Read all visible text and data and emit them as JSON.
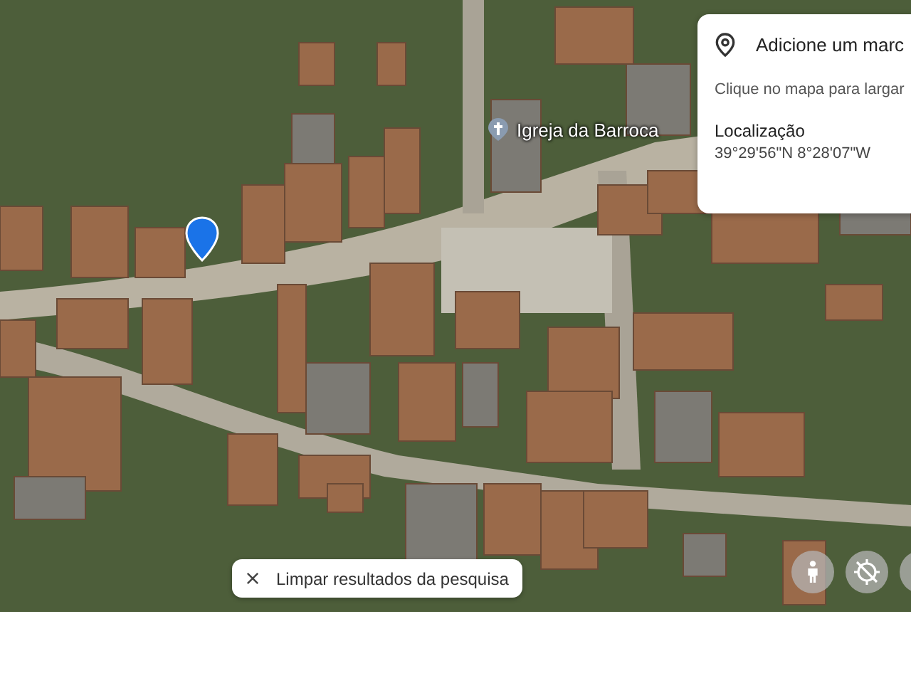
{
  "map": {
    "place_label": "Igreja da Barroca"
  },
  "info_card": {
    "title": "Adicione um marc",
    "hint": "Clique no mapa para largar",
    "location_label": "Localização",
    "coordinates": "39°29'56\"N 8°28'07\"W"
  },
  "search_chip": {
    "label": "Limpar resultados da pesquisa"
  }
}
